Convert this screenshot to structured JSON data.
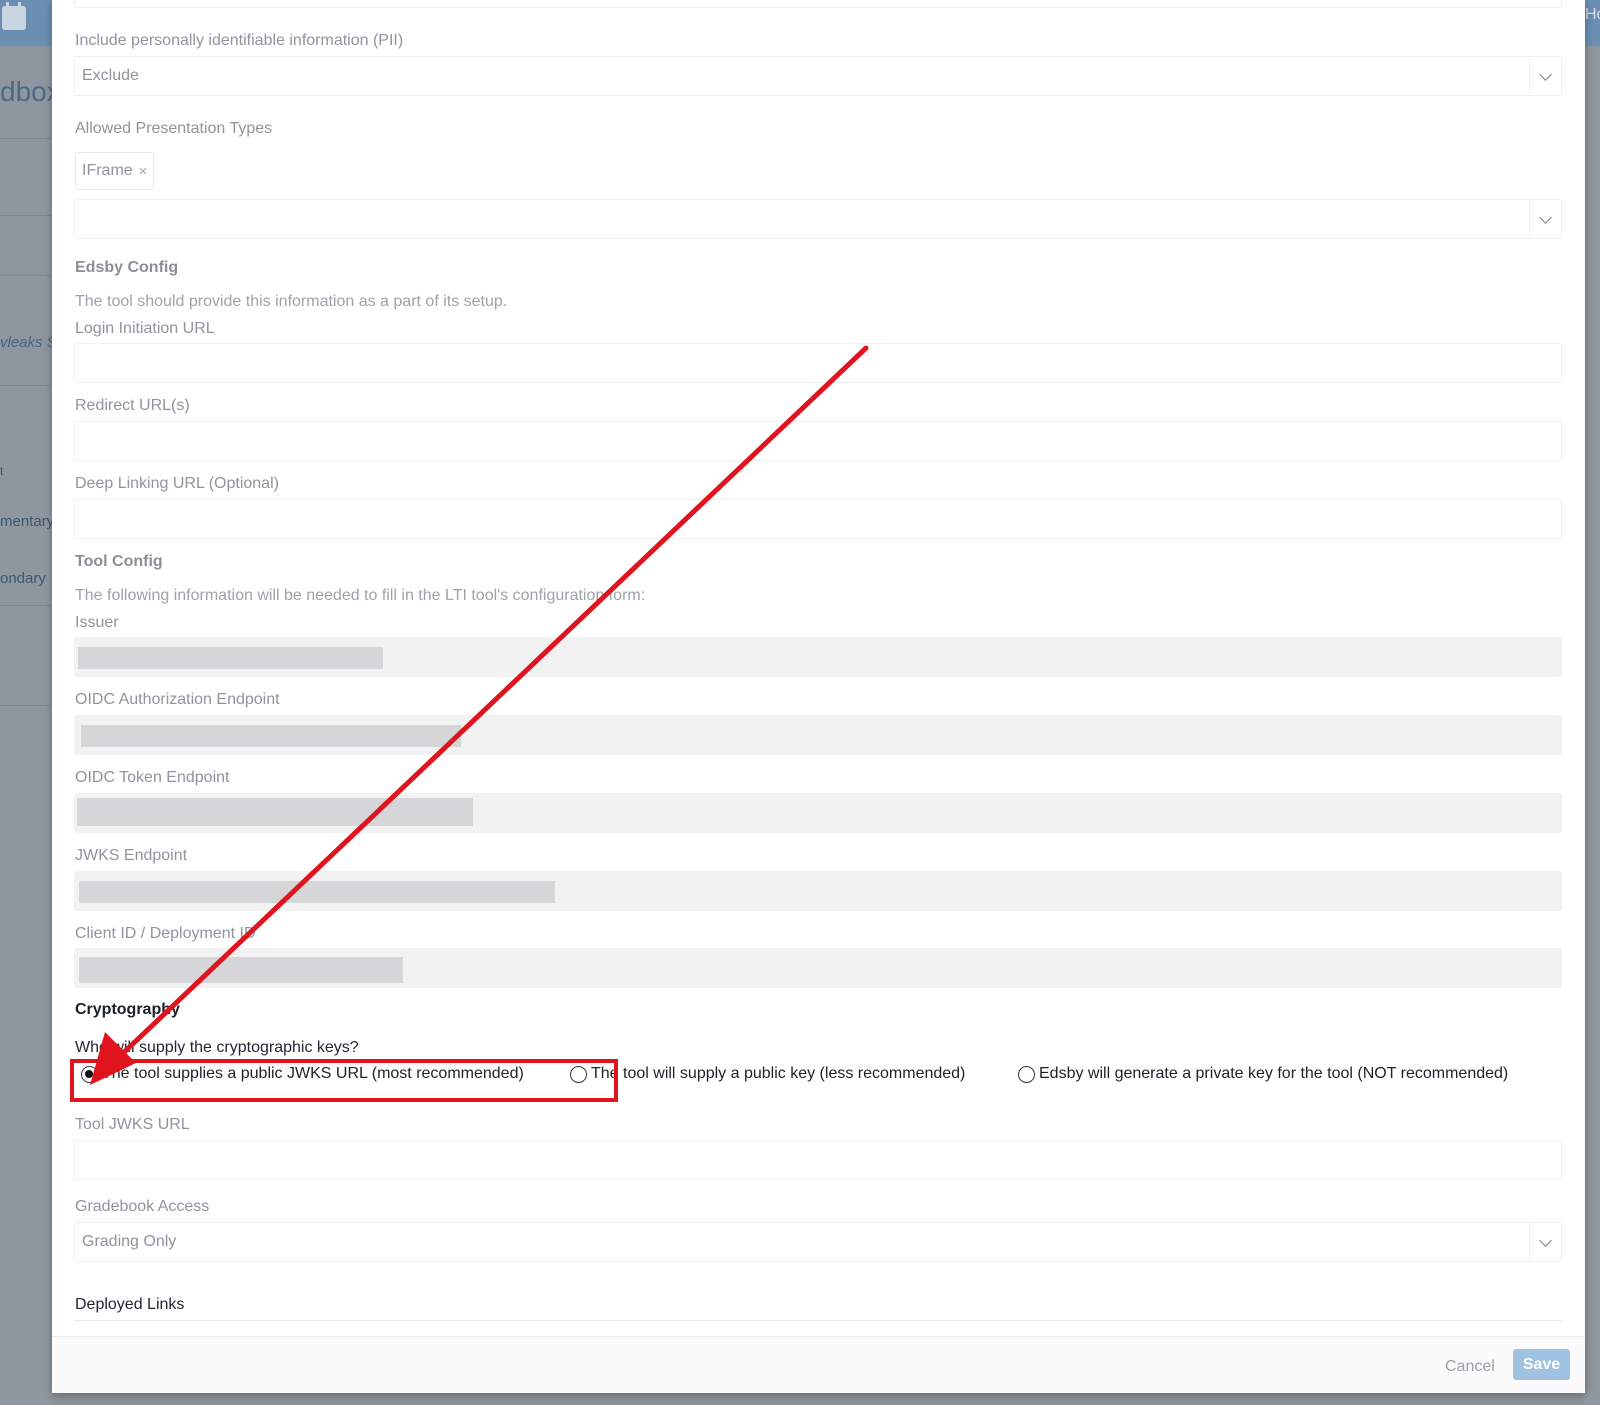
{
  "background": {
    "header_text": "Hc",
    "sidebar_title_fragment": "dbox",
    "sidebar_items": [
      "vleaks S",
      "mentary",
      "ondary"
    ],
    "sidebar_fragment_small": "t"
  },
  "form": {
    "pii": {
      "label": "Include personally identifiable information (PII)",
      "value": "Exclude"
    },
    "presentation": {
      "label": "Allowed Presentation Types",
      "chip": "IFrame",
      "chip_remove": "×"
    },
    "edsby_config": {
      "title": "Edsby Config",
      "help": "The tool should provide this information as a part of its setup.",
      "login_url_label": "Login Initiation URL",
      "redirect_label": "Redirect URL(s)",
      "deep_link_label": "Deep Linking URL (Optional)"
    },
    "tool_config": {
      "title": "Tool Config",
      "help": "The following information will be needed to fill in the LTI tool's configuration form:",
      "issuer_label": "Issuer",
      "oidc_auth_label": "OIDC Authorization Endpoint",
      "oidc_token_label": "OIDC Token Endpoint",
      "jwks_label": "JWKS Endpoint",
      "client_label": "Client ID / Deployment ID"
    },
    "cryptography": {
      "title": "Cryptography",
      "question": "Who will supply the cryptographic keys?",
      "options": [
        {
          "label": "The tool supplies a public JWKS URL (most recommended)",
          "checked": true
        },
        {
          "label": "The tool will supply a public key (less recommended)",
          "checked": false
        },
        {
          "label": "Edsby will generate a private key for the tool (NOT recommended)",
          "checked": false
        }
      ],
      "tool_jwks_label": "Tool JWKS URL"
    },
    "gradebook": {
      "label": "Gradebook Access",
      "value": "Grading Only"
    },
    "deployed_links": {
      "label": "Deployed Links"
    }
  },
  "footer": {
    "cancel": "Cancel",
    "save": "Save"
  },
  "colors": {
    "annotation_red": "#e0141e",
    "save_button": "#9ec2e0",
    "header_blue": "#6b8fb3"
  }
}
